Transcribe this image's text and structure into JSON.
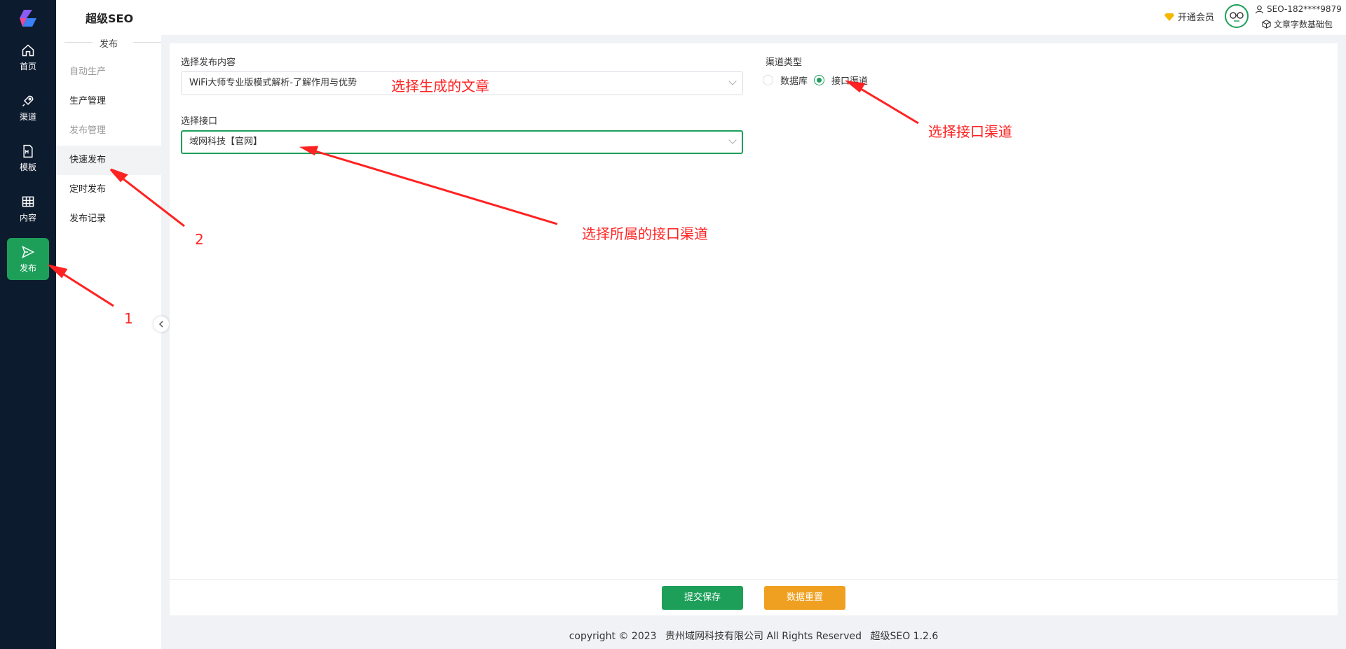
{
  "rail": {
    "items": [
      {
        "label": "首页",
        "icon": "home-icon"
      },
      {
        "label": "渠道",
        "icon": "rocket-icon"
      },
      {
        "label": "模板",
        "icon": "markdown-file-icon"
      },
      {
        "label": "内容",
        "icon": "grid-table-icon"
      },
      {
        "label": "发布",
        "icon": "send-icon",
        "active": true
      }
    ],
    "active_color": "#1d9f5a"
  },
  "submenu": {
    "brand": "超级SEO",
    "section_title": "发布",
    "items": [
      {
        "label": "自动生产",
        "muted": true
      },
      {
        "label": "生产管理"
      },
      {
        "label": "发布管理",
        "muted": true
      },
      {
        "label": "快速发布",
        "active": true
      },
      {
        "label": "定时发布"
      },
      {
        "label": "发布记录"
      }
    ]
  },
  "header": {
    "vip_label": "开通会员",
    "user_name": "SEO-182****9879",
    "package_label": "文章字数基础包"
  },
  "form": {
    "content_label": "选择发布内容",
    "content_value": "WiFi大师专业版模式解析-了解作用与优势",
    "interface_label": "选择接口",
    "interface_value": "域网科技【官网】",
    "channel_type_label": "渠道类型",
    "channel_options": [
      "数据库",
      "接口渠道"
    ],
    "channel_selected": "接口渠道"
  },
  "buttons": {
    "submit": "提交保存",
    "reset": "数据重置"
  },
  "footer": {
    "copyright": "copyright © 2023",
    "company": "贵州域网科技有限公司 All Rights Reserved",
    "version": "超级SEO 1.2.6"
  },
  "annotations": {
    "a1": "选择生成的文章",
    "a2": "选择接口渠道",
    "a3": "选择所属的接口渠道",
    "num1": "1",
    "num2": "2"
  }
}
